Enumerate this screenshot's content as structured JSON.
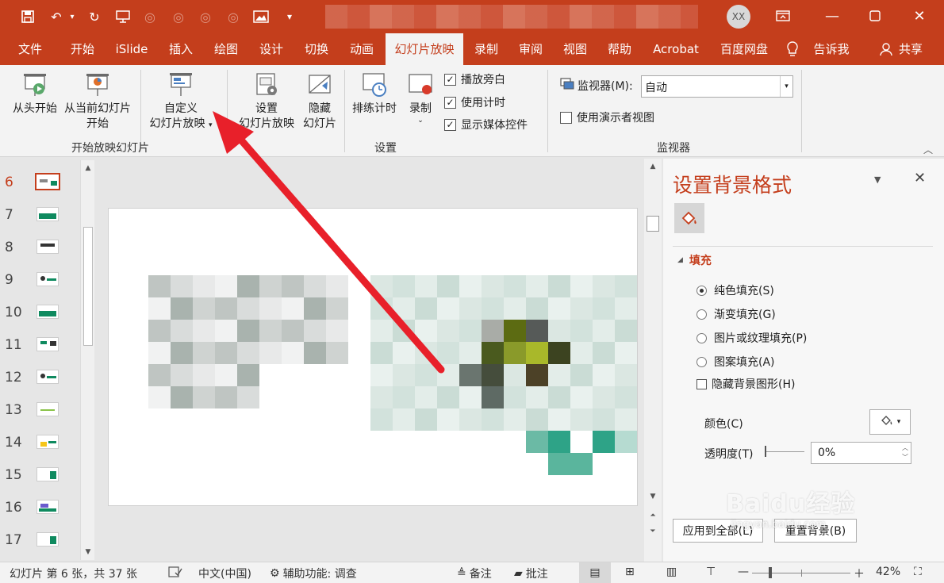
{
  "colors": {
    "accent": "#c43e1c",
    "ribbon_bg": "#f3f3f3",
    "arrow": "#e8202a",
    "slide_green": "#0f8a5f"
  },
  "titlebar": {
    "avatar": "XX"
  },
  "tabs": [
    "文件",
    "开始",
    "iSlide",
    "插入",
    "绘图",
    "设计",
    "切换",
    "动画",
    "幻灯片放映",
    "录制",
    "审阅",
    "视图",
    "帮助",
    "Acrobat",
    "百度网盘",
    "告诉我",
    "共享"
  ],
  "active_tab": "幻灯片放映",
  "ribbon": {
    "from_start": "从头开始",
    "from_current_l1": "从当前幻灯片",
    "from_current_l2": "开始",
    "custom_l1": "自定义",
    "custom_l2": "幻灯片放映",
    "group1": "开始放映幻灯片",
    "setup_l1": "设置",
    "setup_l2": "幻灯片放映",
    "hide_l1": "隐藏",
    "hide_l2": "幻灯片",
    "rehearse": "排练计时",
    "record": "录制",
    "chk_narration": "播放旁白",
    "chk_timing": "使用计时",
    "chk_media": "显示媒体控件",
    "group2": "设置",
    "monitor_label": "监视器(M):",
    "monitor_value": "自动",
    "presenter_view": "使用演示者视图",
    "group3": "监视器"
  },
  "thumbnails": [
    {
      "num": "6",
      "active": true
    },
    {
      "num": "7"
    },
    {
      "num": "8"
    },
    {
      "num": "9"
    },
    {
      "num": "10"
    },
    {
      "num": "11"
    },
    {
      "num": "12"
    },
    {
      "num": "13"
    },
    {
      "num": "14"
    },
    {
      "num": "15"
    },
    {
      "num": "16"
    },
    {
      "num": "17"
    }
  ],
  "pane": {
    "title": "设置背景格式",
    "section": "填充",
    "options": [
      "纯色填充(S)",
      "渐变填充(G)",
      "图片或纹理填充(P)",
      "图案填充(A)"
    ],
    "hide_bg": "隐藏背景图形(H)",
    "color_label": "颜色(C)",
    "transparency_label": "透明度(T)",
    "transparency_value": "0%",
    "apply_all": "应用到全部(L)",
    "reset": "重置背景(B)"
  },
  "statusbar": {
    "slide_info": "幻灯片 第 6 张，共 37 张",
    "language": "中文(中国)",
    "accessibility": "辅助功能: 调查",
    "notes": "备注",
    "comments": "批注",
    "zoom": "42%"
  },
  "watermark": {
    "brand": "Baidu经验",
    "url": "jingyan.baidu.com"
  }
}
